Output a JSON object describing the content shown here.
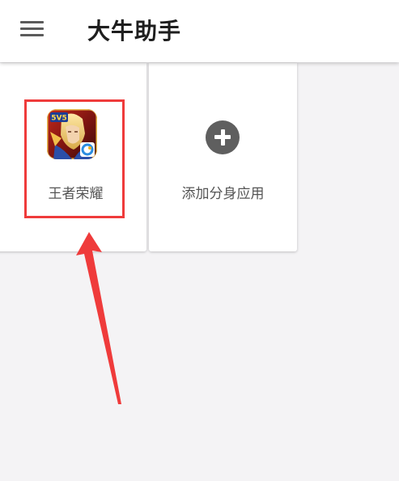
{
  "header": {
    "title": "大牛助手",
    "menu_icon": "hamburger-menu-icon"
  },
  "apps": [
    {
      "label": "王者荣耀",
      "icon": "honor-of-kings-app-icon",
      "badge_text": "5V5"
    }
  ],
  "add_card": {
    "label": "添加分身应用",
    "icon": "plus-circle-icon"
  },
  "annotation": {
    "highlight_color": "#ef3b3b",
    "arrow_color": "#ef3b3b"
  }
}
